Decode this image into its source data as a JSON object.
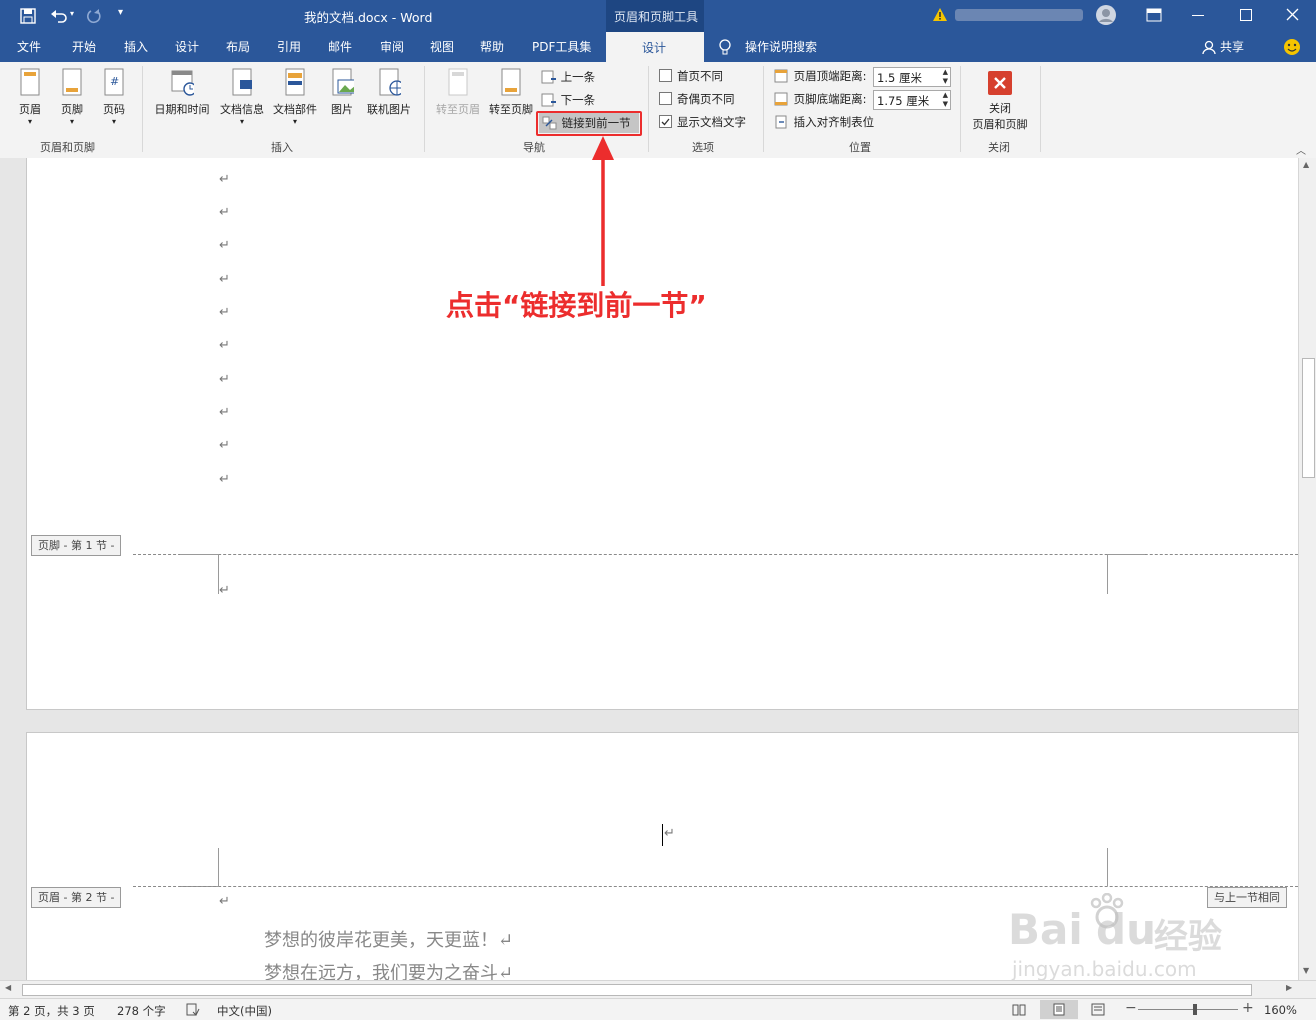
{
  "titlebar": {
    "doc_title": "我的文档.docx  -  Word",
    "tools_label": "页眉和页脚工具",
    "icons": [
      "save-icon",
      "undo-icon",
      "redo-icon",
      "customize-qat-icon",
      "warning-icon",
      "user-avatar-icon",
      "ribbon-display-icon",
      "minimize-icon",
      "maximize-icon",
      "close-icon"
    ]
  },
  "menu": {
    "items": [
      "文件",
      "开始",
      "插入",
      "设计",
      "布局",
      "引用",
      "邮件",
      "审阅",
      "视图",
      "帮助",
      "PDF工具集",
      "设计"
    ],
    "search_label": "操作说明搜索",
    "share_label": "共享"
  },
  "ribbon": {
    "group_header_footer": {
      "label": "页眉和页脚",
      "buttons": [
        "页眉",
        "页脚",
        "页码"
      ]
    },
    "group_insert": {
      "label": "插入",
      "buttons": [
        "日期和时间",
        "文档信息",
        "文档部件",
        "图片",
        "联机图片"
      ]
    },
    "group_nav": {
      "label": "导航",
      "goto_header": "转至页眉",
      "goto_footer": "转至页脚",
      "prev": "上一条",
      "next": "下一条",
      "link_prev": "链接到前一节"
    },
    "group_options": {
      "label": "选项",
      "first_page": "首页不同",
      "odd_even": "奇偶页不同",
      "show_text": "显示文档文字",
      "show_text_checked": true
    },
    "group_position": {
      "label": "位置",
      "header_top": "页眉顶端距离:",
      "header_value": "1.5 厘米",
      "footer_bottom": "页脚底端距离:",
      "footer_value": "1.75 厘米",
      "align_tab": "插入对齐制表位"
    },
    "group_close": {
      "label": "关闭",
      "close_btn_line1": "关闭",
      "close_btn_line2": "页眉和页脚"
    }
  },
  "document": {
    "footer_tag_1": "页脚 - 第 1 节 -",
    "header_tag_2": "页眉 - 第 2 节 -",
    "same_as_prev": "与上一节相同",
    "para_mark": "↵",
    "line1": "梦想的彼岸花更美，天更蓝！↵",
    "line2": "梦想在远方，我们要为之奋斗↵"
  },
  "annotation": {
    "text": "点击“链接到前一节”",
    "color": "#ec2d2d"
  },
  "watermark": {
    "brand": "Bai",
    "brand2": "du",
    "brand_cn": "经验",
    "url": "jingyan.baidu.com"
  },
  "status": {
    "page": "第 2 页，共 3 页",
    "words": "278 个字",
    "language": "中文(中国)",
    "zoom": "160%"
  },
  "colors": {
    "accent": "#2b579a",
    "annotation": "#ec2d2d"
  }
}
